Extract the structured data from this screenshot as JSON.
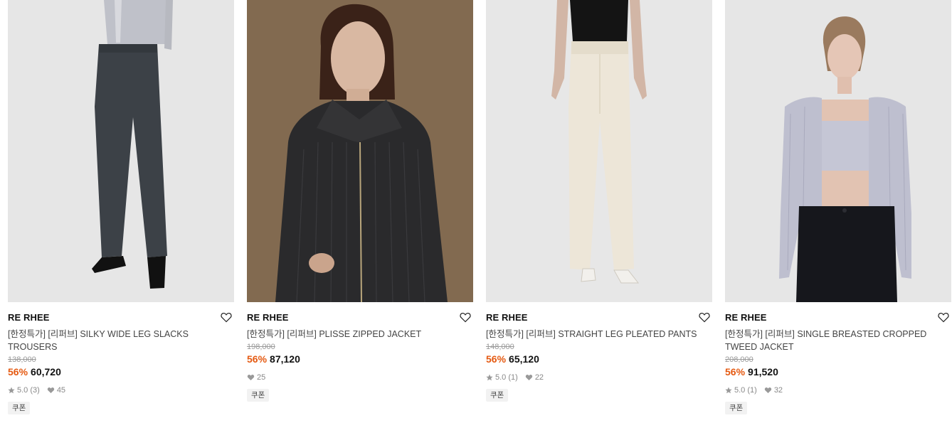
{
  "products": [
    {
      "brand": "RE RHEE",
      "title": "[한정특가] [리퍼브] SILKY WIDE LEG SLACKS TROUSERS",
      "original_price": "138,000",
      "discount": "56%",
      "price": "60,720",
      "rating": "5.0",
      "review_count": "(3)",
      "likes": "45",
      "badge": "쿠폰"
    },
    {
      "brand": "RE RHEE",
      "title": "[한정특가] [리퍼브] PLISSE ZIPPED JACKET",
      "original_price": "198,000",
      "discount": "56%",
      "price": "87,120",
      "likes": "25",
      "badge": "쿠폰"
    },
    {
      "brand": "RE RHEE",
      "title": "[한정특가] [리퍼브] STRAIGHT LEG PLEATED PANTS",
      "original_price": "148,000",
      "discount": "56%",
      "price": "65,120",
      "rating": "5.0",
      "review_count": "(1)",
      "likes": "22",
      "badge": "쿠폰"
    },
    {
      "brand": "RE RHEE",
      "title_line1": "[한정특가] [리퍼브] SINGLE BREASTED CROPPED",
      "title_line2": "TWEED JACKET",
      "original_price": "208,000",
      "discount": "56%",
      "price": "91,520",
      "rating": "5.0",
      "review_count": "(1)",
      "likes": "32",
      "badge": "쿠폰"
    }
  ],
  "colors": {
    "discount": "#e55a12",
    "strike": "#9a9a9a",
    "stat": "#888888"
  },
  "icons": {
    "wishlist": "heart-outline-icon",
    "rating": "star-icon",
    "likes": "heart-filled-icon"
  }
}
